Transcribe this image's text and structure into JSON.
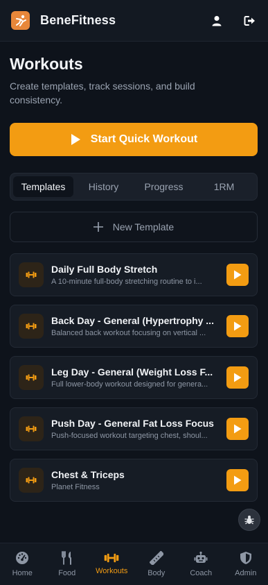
{
  "app": {
    "name": "BeneFitness"
  },
  "colors": {
    "accent": "#f39c12",
    "background": "#0e131b",
    "card": "#161c25"
  },
  "page": {
    "title": "Workouts",
    "subtitle": "Create templates, track sessions, and build consistency."
  },
  "quick_workout_label": "Start Quick Workout",
  "tabs": [
    {
      "label": "Templates",
      "active": true
    },
    {
      "label": "History",
      "active": false
    },
    {
      "label": "Progress",
      "active": false
    },
    {
      "label": "1RM",
      "active": false
    }
  ],
  "new_template_label": "New Template",
  "templates": [
    {
      "title": "Daily Full Body Stretch",
      "desc": "A 10-minute full-body stretching routine to i..."
    },
    {
      "title": "Back Day - General (Hypertrophy ...",
      "desc": "Balanced back workout focusing on vertical ..."
    },
    {
      "title": "Leg Day - General (Weight Loss F...",
      "desc": "Full lower-body workout designed for genera..."
    },
    {
      "title": "Push Day - General Fat Loss Focus",
      "desc": "Push-focused workout targeting chest, shoul..."
    },
    {
      "title": "Chest & Triceps",
      "desc": "Planet Fitness"
    }
  ],
  "nav": [
    {
      "label": "Home",
      "icon": "dashboard-icon"
    },
    {
      "label": "Food",
      "icon": "utensils-icon"
    },
    {
      "label": "Workouts",
      "icon": "dumbbell-icon",
      "active": true
    },
    {
      "label": "Body",
      "icon": "ruler-icon"
    },
    {
      "label": "Coach",
      "icon": "robot-icon"
    },
    {
      "label": "Admin",
      "icon": "shield-icon"
    }
  ]
}
